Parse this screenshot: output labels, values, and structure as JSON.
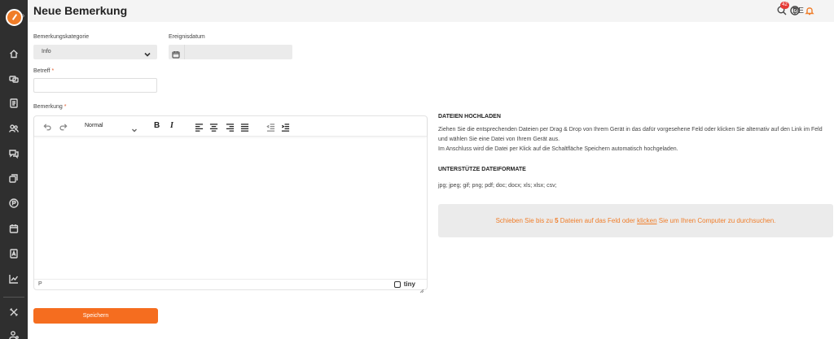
{
  "header": {
    "title": "Neue Bemerkung",
    "notification_count": "42",
    "language": "DE"
  },
  "form": {
    "category_label": "Bemerkungskategorie",
    "category_value": "Info",
    "date_label": "Ereignisdatum",
    "date_value": "",
    "subject_label": "Betreff",
    "subject_value": "",
    "remark_label": "Bemerkung",
    "required_marker": "*",
    "save_label": "Speichern"
  },
  "editor": {
    "format_value": "Normal",
    "bold_label": "B",
    "italic_label": "I",
    "status_path": "P",
    "brand": "tiny"
  },
  "upload": {
    "title": "DATEIEN HOCHLADEN",
    "line1": "Ziehen Sie die entsprechenden Dateien per Drag & Drop von Ihrem Gerät in das dafür vorgesehene Feld oder klicken Sie alternativ auf den Link im Feld",
    "line2": "und wählen Sie eine Datei von Ihrem Gerät aus.",
    "line3": "Im Anschluss wird die Datei per Klick auf die Schaltfläche Speichern automatisch hochgeladen.",
    "formats_title": "UNTERSTÜTZE DATEIFORMATE",
    "formats_list": "jpg; jpeg; gif; png; pdf; doc; docx; xls; xlsx; csv;",
    "drop_prefix": "Schieben Sie bis zu",
    "drop_count": "5",
    "drop_middle": "Dateien auf das Feld oder",
    "drop_link": "klicken",
    "drop_suffix": "Sie um Ihren Computer zu durchsuchen."
  },
  "colors": {
    "accent": "#f56d1f",
    "sidebar": "#2f2f2f",
    "badge": "#e53935"
  },
  "icons": {
    "sidebar": [
      "home-icon",
      "car-icon",
      "document-icon",
      "users-icon",
      "chat-icon",
      "layers-icon",
      "parking-icon",
      "calendar-icon",
      "report-icon",
      "chart-icon",
      "tools-icon",
      "user-settings-icon"
    ],
    "header": [
      "search-icon",
      "help-icon",
      "bell-icon"
    ]
  }
}
